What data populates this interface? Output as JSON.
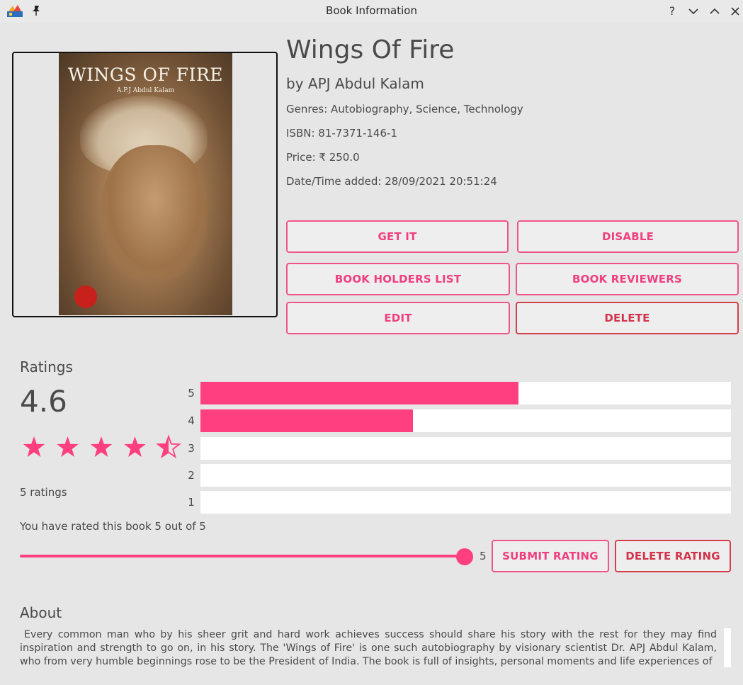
{
  "window": {
    "title": "Book Information",
    "help_icon": "question-mark-icon",
    "minimize_icon": "chevron-down-icon",
    "maximize_icon": "chevron-up-icon",
    "close_icon": "close-icon"
  },
  "cover": {
    "title_text": "WINGS OF FIRE",
    "subtitle_text": "A.P.J Abdul Kalam"
  },
  "book": {
    "title": "Wings Of Fire",
    "author": "by APJ Abdul Kalam",
    "genres": "Genres: Autobiography, Science, Technology",
    "isbn": "ISBN: 81-7371-146-1",
    "price": "Price: ₹ 250.0",
    "date_added": "Date/Time added: 28/09/2021 20:51:24"
  },
  "actions": {
    "get_it": "GET IT",
    "disable": "DISABLE",
    "holders": "BOOK HOLDERS LIST",
    "reviewers": "BOOK REVIEWERS",
    "edit": "EDIT",
    "delete": "DELETE"
  },
  "ratings": {
    "heading": "Ratings",
    "average": "4.6",
    "average_stars": 4.5,
    "count_text": "5 ratings",
    "distribution": [
      {
        "label": "5",
        "fraction": 0.6
      },
      {
        "label": "4",
        "fraction": 0.4
      },
      {
        "label": "3",
        "fraction": 0
      },
      {
        "label": "2",
        "fraction": 0
      },
      {
        "label": "1",
        "fraction": 0
      }
    ],
    "your_rating_text": "You have rated this book 5 out of 5",
    "slider_value": "5",
    "slider_fraction": 1.0,
    "submit_label": "SUBMIT RATING",
    "delete_label": "DELETE RATING"
  },
  "about": {
    "heading": "About",
    "text": "Every common man who by his sheer grit and hard work achieves success should share his story with the rest for they may find inspiration and strength to go on, in his story. The 'Wings of Fire' is one such autobiography by visionary scientist Dr. APJ Abdul Kalam, who from very humble beginnings rose to be the President of India. The book is full of insights, personal moments and life experiences of"
  },
  "colors": {
    "accent": "#ff3f80",
    "danger": "#d2334a",
    "background": "#e6e6e6"
  }
}
